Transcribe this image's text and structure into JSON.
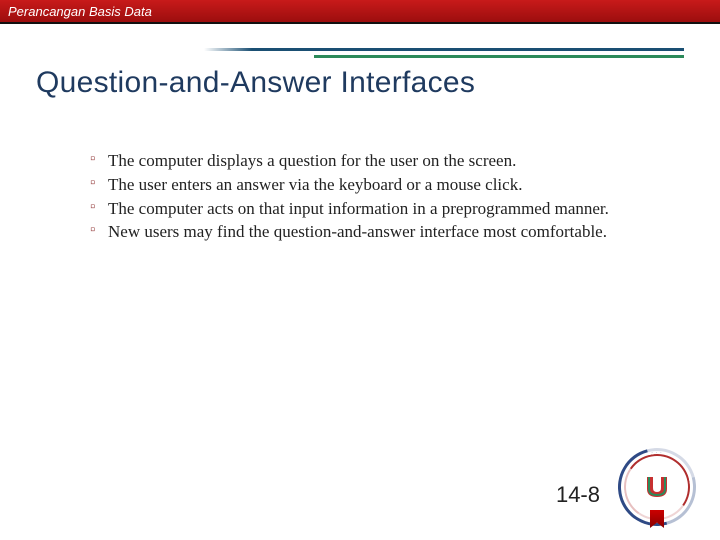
{
  "header": {
    "course_title": "Perancangan Basis Data"
  },
  "title": "Question-and-Answer Interfaces",
  "bullets": [
    "The computer displays a question for the user on the screen.",
    "The user enters an answer via the keyboard or a mouse click.",
    "The computer acts on that input information in a preprogrammed manner.",
    "New users may find the question-and-answer interface most comfortable."
  ],
  "page_number": "14-8",
  "logo": {
    "letter": "U"
  }
}
